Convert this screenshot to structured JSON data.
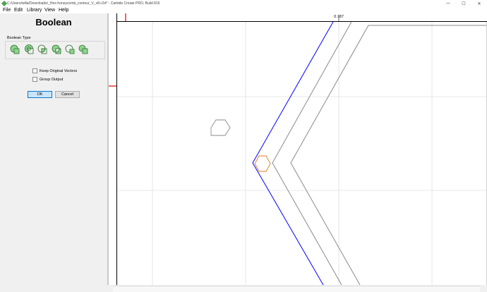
{
  "window": {
    "title": "C:/Users/willa/Downloads/_Hex-honeycomb_contour_V_v8.c2d* - Carbide Create PRO, Build 816",
    "minimize_glyph": "—",
    "maximize_glyph": "☐",
    "close_glyph": "✕"
  },
  "menu": {
    "file": "File",
    "edit": "Edit",
    "library": "Library",
    "view": "View",
    "help": "Help"
  },
  "panel": {
    "title": "Boolean",
    "boolean_type_label": "Boolean Type",
    "boolean_types": [
      "union",
      "subtract",
      "intersect",
      "exclusive-or",
      "subtract-reverse",
      "merge"
    ],
    "keep_original_vectors": "Keep Original Vectors",
    "group_output": "Group Output",
    "ok": "OK",
    "cancel": "Cancel"
  },
  "canvas": {
    "ruler_value": "0.787"
  },
  "colors": {
    "selected_path": "#0000ff",
    "highlight_hex": "#e07b20",
    "path": "#8a8a8a",
    "grid": "#e0e0e0",
    "ruler_marker": "#e00000",
    "boolean_icon_fill": "#8ed48e",
    "boolean_icon_stroke": "#2f6e2f"
  }
}
